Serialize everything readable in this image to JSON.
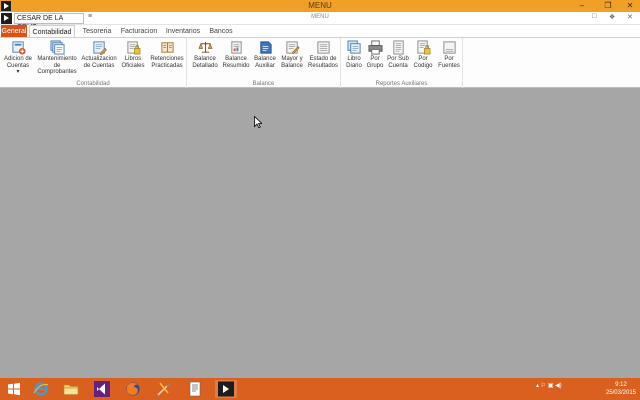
{
  "window": {
    "title": "MENU",
    "controls": {
      "minimize": "–",
      "restore": "❐",
      "close": "✕"
    }
  },
  "quick_access": {
    "company": "CESAR DE LA CRUZ",
    "dropdown_glyph": "≡",
    "subtitle": "MENU",
    "right_icons": [
      "□",
      "❖",
      "✕"
    ]
  },
  "tabs": [
    {
      "label": "General"
    },
    {
      "label": "Contabilidad"
    },
    {
      "label": "Tesoreria"
    },
    {
      "label": "Facturacion"
    },
    {
      "label": "Inventarios"
    },
    {
      "label": "Bancos"
    }
  ],
  "groups": {
    "contabilidad": {
      "label": "Contabilidad",
      "buttons": [
        {
          "label": "Adicion de\nCuentas\n▾",
          "icon": "add-account-icon"
        },
        {
          "label": "Mantenimiento\nde\nComprobantes",
          "icon": "vouchers-icon"
        },
        {
          "label": "Actualizacion\nde Cuentas",
          "icon": "update-accounts-icon"
        },
        {
          "label": "Libros\nOficiales",
          "icon": "official-books-icon"
        },
        {
          "label": "Retenciones\nPracticadas",
          "icon": "withholdings-icon"
        }
      ]
    },
    "balance": {
      "label": "Balance",
      "buttons": [
        {
          "label": "Balance\nDetallado",
          "icon": "scale-icon"
        },
        {
          "label": "Balance\nResumido",
          "icon": "summary-balance-icon"
        },
        {
          "label": "Balance\nAuxiliar",
          "icon": "auxiliary-balance-icon"
        },
        {
          "label": "Mayor y\nBalance",
          "icon": "ledger-icon"
        },
        {
          "label": "Estado de\nResultados",
          "icon": "results-statement-icon"
        }
      ]
    },
    "reportes": {
      "label": "Reportes Auxiliares",
      "buttons": [
        {
          "label": "Libro\nDiario",
          "icon": "daily-book-icon"
        },
        {
          "label": "Por\nGrupo",
          "icon": "printer-icon"
        },
        {
          "label": "Por Sub\nCuenta",
          "icon": "subaccount-icon"
        },
        {
          "label": "Por\nCodigo",
          "icon": "code-lock-icon"
        },
        {
          "label": "Por\nFuentes",
          "icon": "sources-icon"
        }
      ]
    }
  },
  "colors": {
    "title_bar": "#f1a027",
    "accent": "#d8521b",
    "taskbar": "#d9601f",
    "workspace": "#a6a6a6"
  },
  "taskbar": {
    "apps": [
      "windows-start-icon",
      "internet-explorer-icon",
      "file-explorer-icon",
      "visual-studio-icon",
      "firefox-icon",
      "tools-icon",
      "document-icon",
      "app-menu-icon"
    ],
    "tray": "▴ ⚐ ▣ ◀)",
    "time": "9:12",
    "date": "25/03/2015"
  }
}
